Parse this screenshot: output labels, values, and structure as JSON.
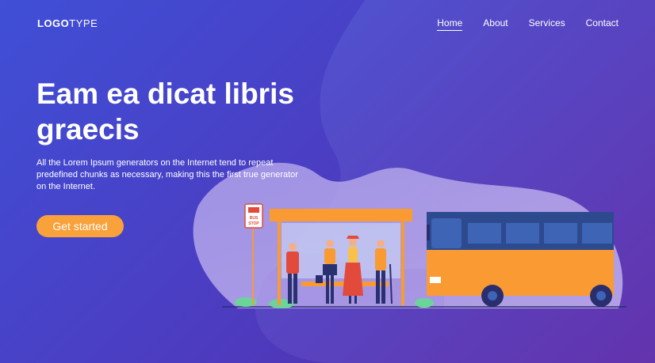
{
  "header": {
    "logo_bold": "LOGO",
    "logo_light": "TYPE",
    "nav": [
      {
        "label": "Home",
        "active": true
      },
      {
        "label": "About",
        "active": false
      },
      {
        "label": "Services",
        "active": false
      },
      {
        "label": "Contact",
        "active": false
      }
    ]
  },
  "hero": {
    "title": "Eam ea dicat libris graecis",
    "text": "All the Lorem Ipsum generators on the Internet tend to repeat predefined chunks as necessary, making this the first true generator on the Internet.",
    "cta_label": "Get started"
  },
  "illustration": {
    "sign_line1": "BUS",
    "sign_line2": "STOP"
  },
  "colors": {
    "accent": "#f9a13a",
    "bus_orange": "#f99a33",
    "bus_blue": "#2d4a8f"
  }
}
